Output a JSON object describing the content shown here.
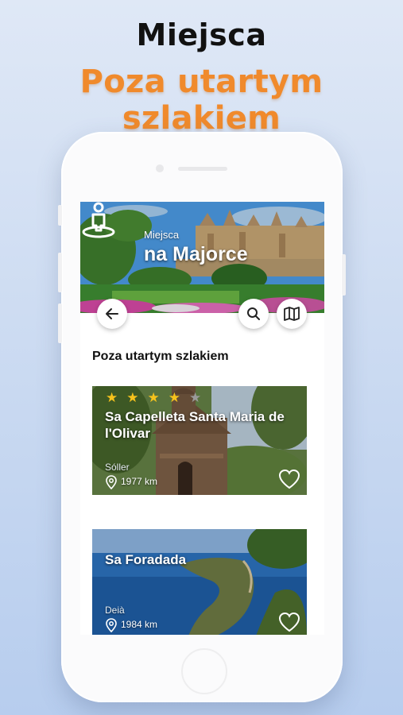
{
  "promo": {
    "title": "Miejsca",
    "subtitle": "Poza utartym szlakiem"
  },
  "header": {
    "small_label": "Miejsca",
    "big_label": "na Majorce",
    "logo_icon": "person-map-pin-icon"
  },
  "toolbar": {
    "back_icon": "arrow-left-icon",
    "search_icon": "search-icon",
    "map_icon": "map-icon"
  },
  "section": {
    "title": "Poza utartym szlakiem"
  },
  "places": [
    {
      "name": "Sa Capelleta Santa Maria de l'Olivar",
      "city": "Sóller",
      "distance": "1977 km",
      "rating": 4,
      "rating_max": 5,
      "favorite": false
    },
    {
      "name": "Sa Foradada",
      "city": "Deià",
      "distance": "1984 km",
      "favorite": false
    }
  ],
  "colors": {
    "accent_orange": "#f08a2c",
    "star_gold": "#f6c21c",
    "star_grey": "#9a9a9a"
  }
}
